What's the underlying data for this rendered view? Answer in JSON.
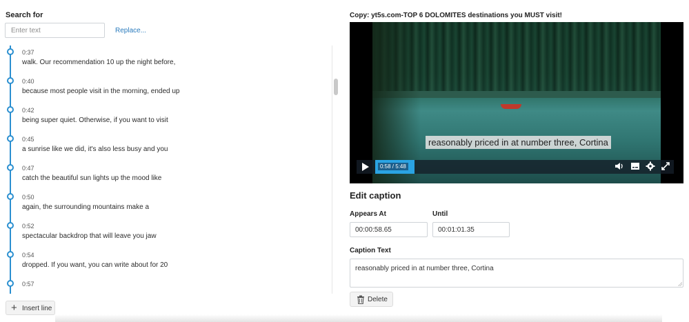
{
  "search": {
    "label": "Search for",
    "placeholder": "Enter text",
    "replace_label": "Replace..."
  },
  "captions": [
    {
      "time": "0:37",
      "text": "walk. Our recommendation 10 up the night before,"
    },
    {
      "time": "0:40",
      "text": "because most people visit in the morning, ended up"
    },
    {
      "time": "0:42",
      "text": "being super quiet. Otherwise, if you want to visit"
    },
    {
      "time": "0:45",
      "text": "a sunrise like we did, it's also less busy and you"
    },
    {
      "time": "0:47",
      "text": "catch the beautiful sun lights up the mood like"
    },
    {
      "time": "0:50",
      "text": "again, the surrounding mountains make a"
    },
    {
      "time": "0:52",
      "text": "spectacular backdrop that will leave you jaw"
    },
    {
      "time": "0:54",
      "text": "dropped. If you want, you can write about for 20"
    },
    {
      "time": "0:57",
      "text": ""
    }
  ],
  "insert_line_label": "Insert line",
  "video": {
    "title": "Copy: yt5s.com-TOP 6 DOLOMITES destinations you MUST visit!",
    "subtitle": "reasonably priced in at number three, Cortina",
    "time_display": "0:58 / 5:48",
    "progress_fraction": 0.167,
    "icons": [
      "play-icon",
      "volume-icon",
      "captions-icon",
      "settings-icon",
      "fullscreen-icon"
    ]
  },
  "edit": {
    "heading": "Edit caption",
    "appears_label": "Appears At",
    "appears_value": "00:00:58.65",
    "until_label": "Until",
    "until_value": "00:01:01.35",
    "caption_text_label": "Caption Text",
    "caption_text_value": "reasonably priced in at number three, Cortina",
    "delete_label": "Delete"
  },
  "colors": {
    "accent": "#2a8fd0",
    "link": "#2a7bbd",
    "progress": "#2aa3e3"
  }
}
